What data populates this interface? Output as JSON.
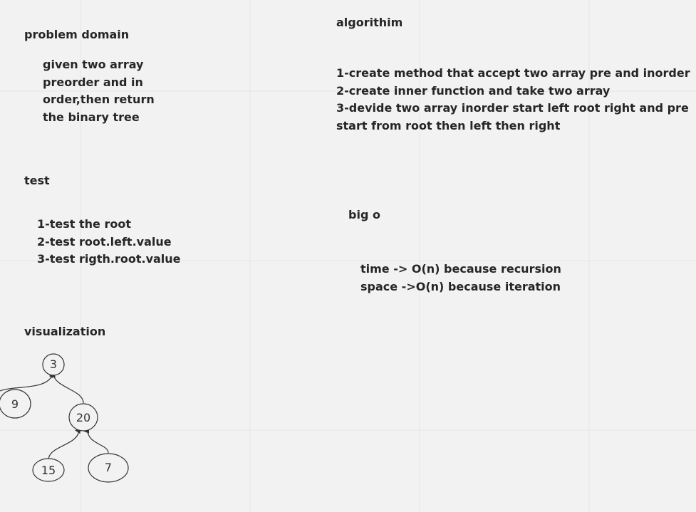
{
  "problem": {
    "heading": "problem domain",
    "lines": [
      "given two array",
      "preorder and in",
      "order,then return",
      "the binary tree"
    ]
  },
  "test": {
    "heading": "test",
    "lines": [
      "1-test the root",
      "2-test root.left.value",
      "3-test rigth.root.value"
    ]
  },
  "visualization": {
    "heading": "visualization",
    "nodes": {
      "root": "3",
      "left": "9",
      "right": "20",
      "right_left": "15",
      "right_right": "7"
    }
  },
  "algorithm": {
    "heading": "algorithim",
    "lines": [
      "1-create method that accept two array pre and inorder",
      "2-create inner function and take two array",
      "3-devide two array inorder start left root right and pre",
      "start from root then left then right"
    ]
  },
  "bigo": {
    "heading": "big o",
    "lines": [
      "time -> O(n) because recursion",
      "space ->O(n) because iteration"
    ]
  }
}
